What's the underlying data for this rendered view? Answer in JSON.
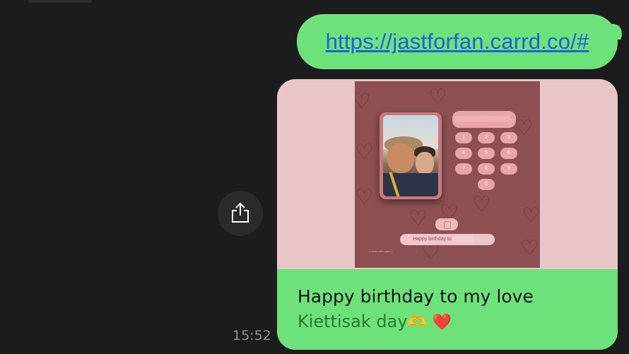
{
  "message": {
    "link_text": "https://jastforfan.carrd.co/#",
    "timestamp": "15:52"
  },
  "preview": {
    "code_placeholder": "▒▒▒▒▒▒▒▒▒▒▒▒▒▒▒▒...",
    "keypad": [
      "1",
      "2",
      "3",
      "4",
      "5",
      "6",
      "7",
      "8",
      "9",
      "0"
    ],
    "birthday_text": "Happy birthday to",
    "birthday_blurred": "▒▒▒▒▒▒",
    "made_with": "( made with carrd )"
  },
  "caption": {
    "title": "Happy birthday to my love",
    "subtitle": "Kiettisak day",
    "emoji_hands": "🫶",
    "emoji_heart": "❤️"
  },
  "icons": {
    "share": "share-icon"
  },
  "colors": {
    "bubble_green": "#6ee27a",
    "link_blue": "#1f5fe0",
    "background": "#1c1c1e",
    "preview_bg": "#8d4f52"
  }
}
